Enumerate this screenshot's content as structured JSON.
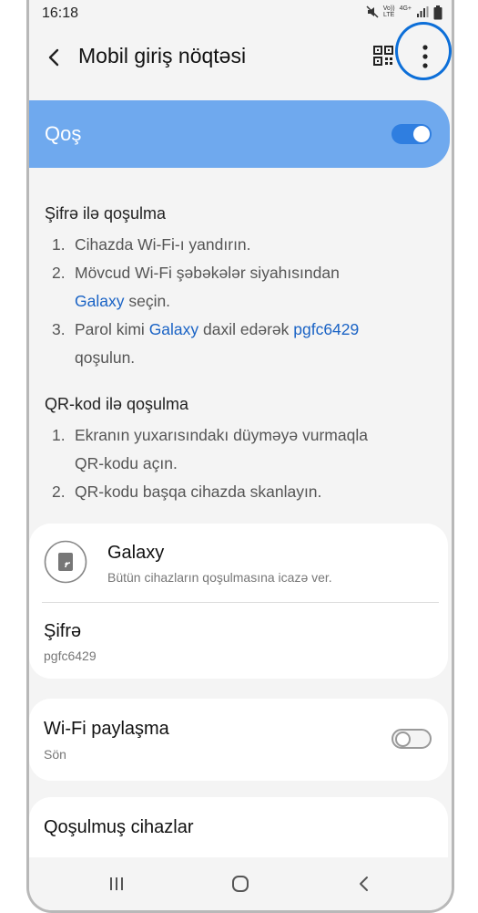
{
  "status": {
    "time": "16:18",
    "volte": "Vo))",
    "lte": "LTE",
    "net": "4G+"
  },
  "appbar": {
    "title": "Mobil giriş nöqtəsi"
  },
  "hotspot": {
    "label": "Qoş",
    "enabled": true
  },
  "password_method": {
    "heading": "Şifrə ilə qoşulma",
    "steps": [
      {
        "num": "1.",
        "text": "Cihazda Wi-Fi-ı yandırın."
      },
      {
        "num": "2.",
        "line1": "Mövcud Wi-Fi şəbəkələr siyahısından",
        "name": "Galaxy",
        "line2_rest": " seçin."
      },
      {
        "num": "3.",
        "pre": "Parol kimi ",
        "name": "Galaxy",
        "mid": " daxil edərək ",
        "password": "pgfc6429",
        "line2": "qoşulun."
      }
    ]
  },
  "qr_method": {
    "heading": "QR-kod ilə qoşulma",
    "steps": [
      {
        "num": "1.",
        "line1": "Ekranın yuxarısındakı düyməyə vurmaqla",
        "line2": "QR-kodu açın."
      },
      {
        "num": "2.",
        "text": "QR-kodu başqa cihazda skanlayın."
      }
    ]
  },
  "network": {
    "name": "Galaxy",
    "subtitle": "Bütün cihazların qoşulmasına icazə ver."
  },
  "password": {
    "label": "Şifrə",
    "value": "pgfc6429"
  },
  "wifi_sharing": {
    "label": "Wi-Fi paylaşma",
    "status": "Sön",
    "enabled": false
  },
  "connected": {
    "label": "Qoşulmuş cihazlar"
  },
  "colors": {
    "accent": "#1a63c5",
    "bar": "#6fa9ee",
    "highlight": "#0d6fd8"
  },
  "icons": [
    "back-arrow-icon",
    "qr-code-icon",
    "more-options-icon",
    "hotspot-device-icon",
    "mute-icon",
    "signal-icon",
    "battery-icon",
    "recents-icon",
    "home-icon",
    "nav-back-icon"
  ]
}
